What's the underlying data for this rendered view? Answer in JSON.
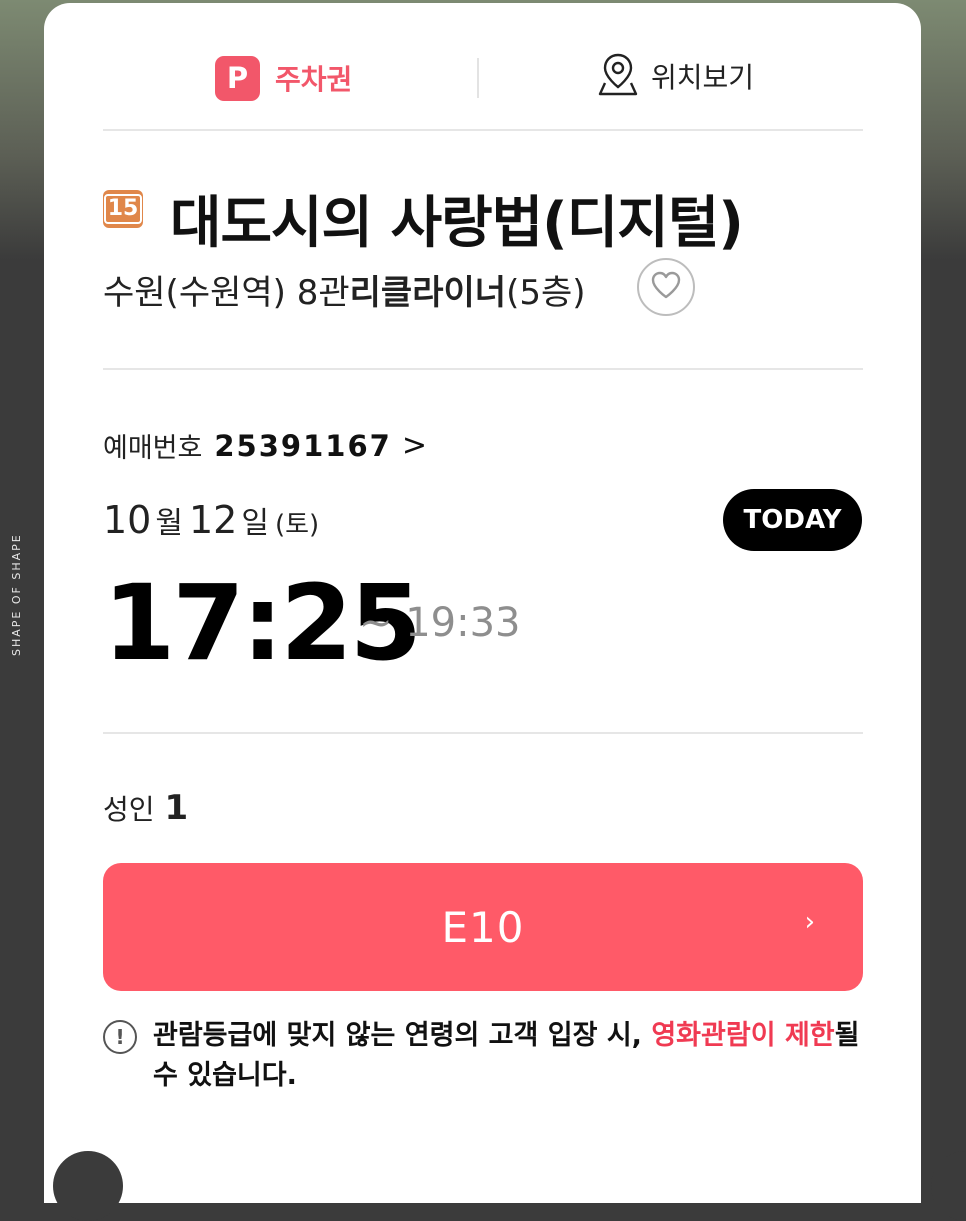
{
  "side_caption": "SHAPE OF SHAPE",
  "tabs": {
    "parking": {
      "icon": "P",
      "label": "주차권"
    },
    "location": {
      "label": "위치보기"
    }
  },
  "movie": {
    "rating": "15",
    "title": "대도시의 사랑법(디지털)",
    "theater": "수원(수원역) 8관",
    "screen_name": "리클라이너",
    "floor": "(5층)"
  },
  "booking": {
    "label": "예매번호",
    "number": "25391167",
    "chevron": ">"
  },
  "schedule": {
    "month": "10",
    "month_unit": "월",
    "day": "12",
    "day_unit": "일",
    "weekday": "(토)",
    "today_badge": "TODAY",
    "start_time": "17:25",
    "end_time": "~ 19:33"
  },
  "audience": {
    "label": "성인",
    "count": "1"
  },
  "seat": {
    "label": "E10",
    "chevron": "›"
  },
  "notice": {
    "icon": "!",
    "text_before": "관람등급에 맞지 않는 연령의 고객 입장 시, ",
    "highlight": "영화관람이 제한",
    "text_after": "될 수 있습니다."
  },
  "colors": {
    "accent": "#f2576a",
    "seat_button": "#ff5a68",
    "notice_highlight": "#f03a52",
    "rating_15": "#e0874a"
  }
}
